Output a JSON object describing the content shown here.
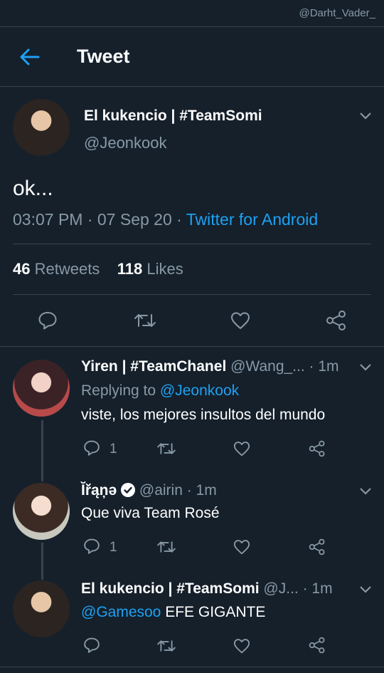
{
  "watermark": "@Darht_Vader_",
  "header": {
    "title": "Tweet"
  },
  "main_tweet": {
    "name": "El kukencio | #TeamSomi",
    "handle": "@Jeonkook",
    "text": "ok...",
    "time": "03:07 PM · 07 Sep 20 · ",
    "source": "Twitter for Android",
    "retweets_count": "46",
    "retweets_label": " Retweets",
    "likes_count": "118",
    "likes_label": " Likes"
  },
  "replies": [
    {
      "name": "Yiren | #TeamChanel",
      "handle": " @Wang_... · 1m",
      "replying_label": "Replying to ",
      "replying_to": "@Jeonkook",
      "text": "viste, los mejores insultos del mundo",
      "reply_count": "1"
    },
    {
      "name": "Ĭřąņə",
      "handle": " @airin · 1m",
      "text": "Que viva Team Rosé",
      "reply_count": "1"
    },
    {
      "name": "El kukencio | #TeamSomi",
      "handle": " @J... · 1m",
      "mention": "@Gamesoo",
      "text": " EFE GIGANTE",
      "reply_count": ""
    }
  ],
  "colors": {
    "background": "#15202b",
    "accent": "#1da1f2",
    "secondary": "#8899a6",
    "divider": "#38444d"
  },
  "icons": [
    "back-arrow-icon",
    "chevron-down-icon",
    "reply-icon",
    "retweet-icon",
    "like-icon",
    "share-icon",
    "verified-icon"
  ]
}
